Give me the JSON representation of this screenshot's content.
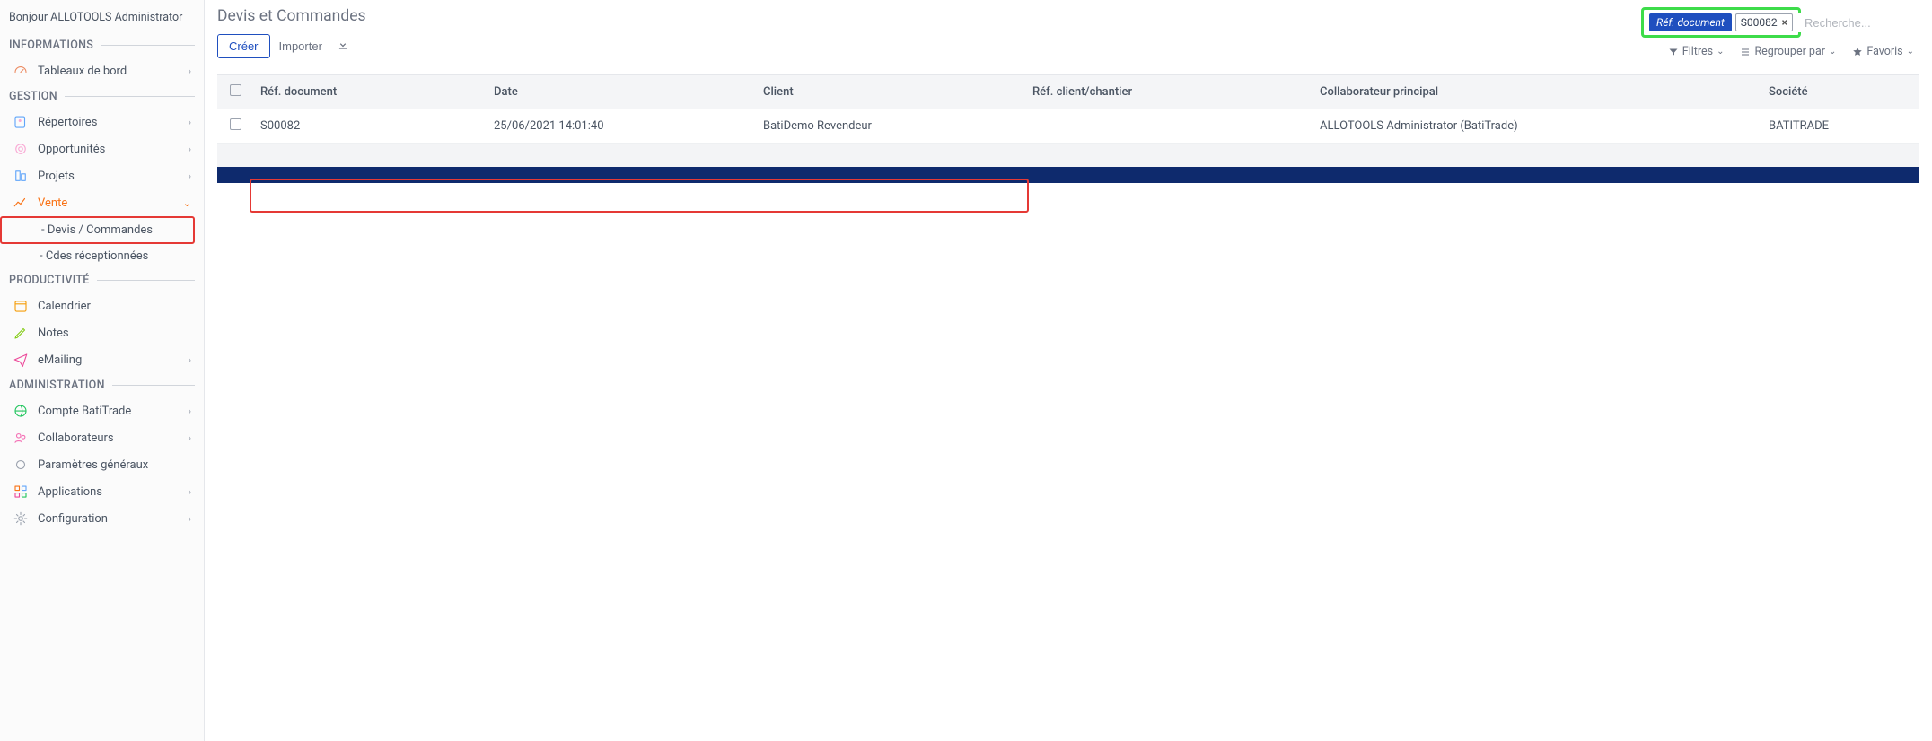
{
  "sidebar": {
    "greeting": "Bonjour ALLOTOOLS Administrator",
    "sections": {
      "informations": {
        "title": "INFORMATIONS"
      },
      "gestion": {
        "title": "GESTION"
      },
      "productivite": {
        "title": "PRODUCTIVITÉ"
      },
      "administration": {
        "title": "ADMINISTRATION"
      }
    },
    "items": {
      "tableaux": "Tableaux de bord",
      "repertoires": "Répertoires",
      "opportunites": "Opportunités",
      "projets": "Projets",
      "vente": "Vente",
      "devis_commandes": "- Devis / Commandes",
      "cdes_receptionnees": "- Cdes réceptionnées",
      "calendrier": "Calendrier",
      "notes": "Notes",
      "emailing": "eMailing",
      "compte_batitrade": "Compte BatiTrade",
      "collaborateurs": "Collaborateurs",
      "parametres": "Paramètres généraux",
      "applications": "Applications",
      "configuration": "Configuration"
    }
  },
  "main": {
    "title": "Devis et Commandes",
    "actions": {
      "create": "Créer",
      "import": "Importer"
    },
    "search": {
      "filter_label": "Réf. document",
      "filter_value": "S00082",
      "placeholder": "Recherche..."
    },
    "filters": {
      "filtres": "Filtres",
      "regrouper": "Regrouper par",
      "favoris": "Favoris"
    },
    "table": {
      "headers": {
        "ref": "Réf. document",
        "date": "Date",
        "client": "Client",
        "ref_client": "Réf. client/chantier",
        "collab": "Collaborateur principal",
        "societe": "Société"
      },
      "rows": [
        {
          "ref": "S00082",
          "date": "25/06/2021 14:01:40",
          "client": "BatiDemo Revendeur",
          "ref_client": "",
          "collab": "ALLOTOOLS Administrator (BatiTrade)",
          "societe": "BATITRADE"
        }
      ]
    }
  }
}
